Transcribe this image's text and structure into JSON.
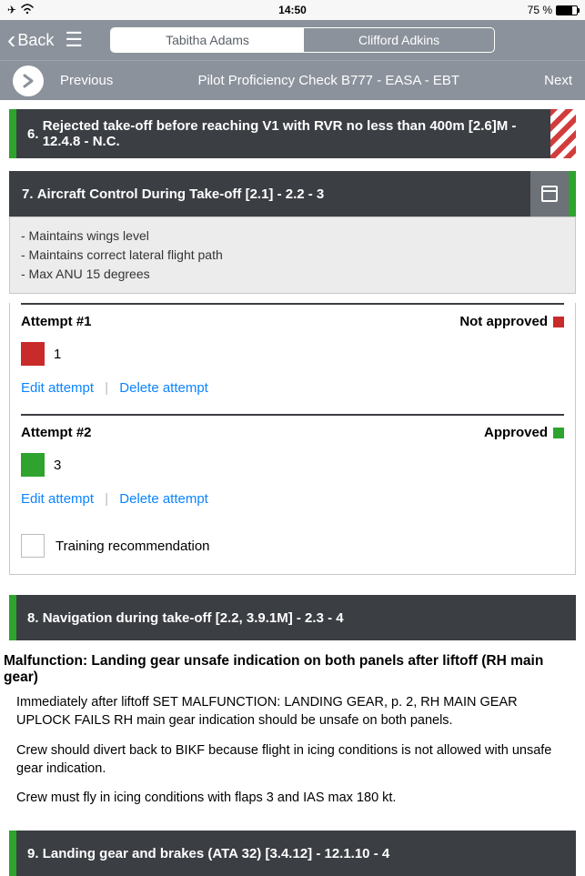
{
  "status": {
    "time": "14:50",
    "battery": "75 %"
  },
  "nav": {
    "back": "Back"
  },
  "tabs": {
    "active": "Tabitha Adams",
    "inactive": "Clifford Adkins"
  },
  "subbar": {
    "prev": "Previous",
    "title": "Pilot Proficiency Check B777 - EASA - EBT",
    "next": "Next"
  },
  "sec6": {
    "num": "6.",
    "title": "Rejected take-off before reaching V1 with RVR no less than 400m [2.6]M - 12.4.8 - N.C."
  },
  "sec7": {
    "num": "7.",
    "title": "Aircraft Control During Take-off [2.1] - 2.2 - 3"
  },
  "criteria": {
    "l1": "- Maintains wings level",
    "l2": "- Maintains correct lateral flight path",
    "l3": "- Max ANU 15 degrees"
  },
  "att1": {
    "title": "Attempt #1",
    "status": "Not approved",
    "score": "1"
  },
  "att2": {
    "title": "Attempt #2",
    "status": "Approved",
    "score": "3"
  },
  "links": {
    "edit": "Edit attempt",
    "del": "Delete attempt"
  },
  "rec": {
    "label": "Training recommendation"
  },
  "sec8": {
    "num": "8.",
    "title": "Navigation during take-off [2.2, 3.9.1M] - 2.3 - 4"
  },
  "malfunction": "Malfunction: Landing gear unsafe indication on both panels after liftoff (RH main gear)",
  "body": {
    "p1": "Immediately after liftoff SET MALFUNCTION: LANDING GEAR, p. 2, RH MAIN GEAR UPLOCK FAILS RH main gear indication should be unsafe on both panels.",
    "p2": "Crew should divert back to BIKF because flight in icing conditions is not allowed with unsafe gear indication.",
    "p3": "Crew must fly in icing conditions with flaps 3 and IAS max 180 kt."
  },
  "sec9": {
    "num": "9.",
    "title": "Landing gear and brakes (ATA 32) [3.4.12] - 12.1.10 - 4"
  }
}
